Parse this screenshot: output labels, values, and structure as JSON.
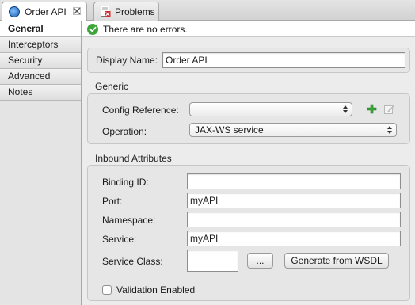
{
  "tabs": [
    {
      "label": "Order API",
      "icon": "globe-icon",
      "active": true
    },
    {
      "label": "Problems",
      "icon": "problems-icon",
      "active": false
    }
  ],
  "status": {
    "message": "There are no errors.",
    "icon": "check-circle-icon"
  },
  "sidebar": {
    "items": [
      {
        "label": "General"
      },
      {
        "label": "Interceptors"
      },
      {
        "label": "Security"
      },
      {
        "label": "Advanced"
      },
      {
        "label": "Notes"
      }
    ]
  },
  "form": {
    "display_name_label": "Display Name:",
    "display_name_value": "Order API",
    "generic_title": "Generic",
    "config_reference_label": "Config Reference:",
    "config_reference_value": "",
    "operation_label": "Operation:",
    "operation_value": "JAX-WS service",
    "inbound_title": "Inbound Attributes",
    "binding_id_label": "Binding ID:",
    "binding_id_value": "",
    "port_label": "Port:",
    "port_value": "myAPI",
    "namespace_label": "Namespace:",
    "namespace_value": "",
    "service_label": "Service:",
    "service_value": "myAPI",
    "service_class_label": "Service Class:",
    "service_class_value": "",
    "browse_label": "...",
    "generate_label": "Generate from WSDL",
    "validation_label": "Validation Enabled",
    "validation_checked": false
  }
}
